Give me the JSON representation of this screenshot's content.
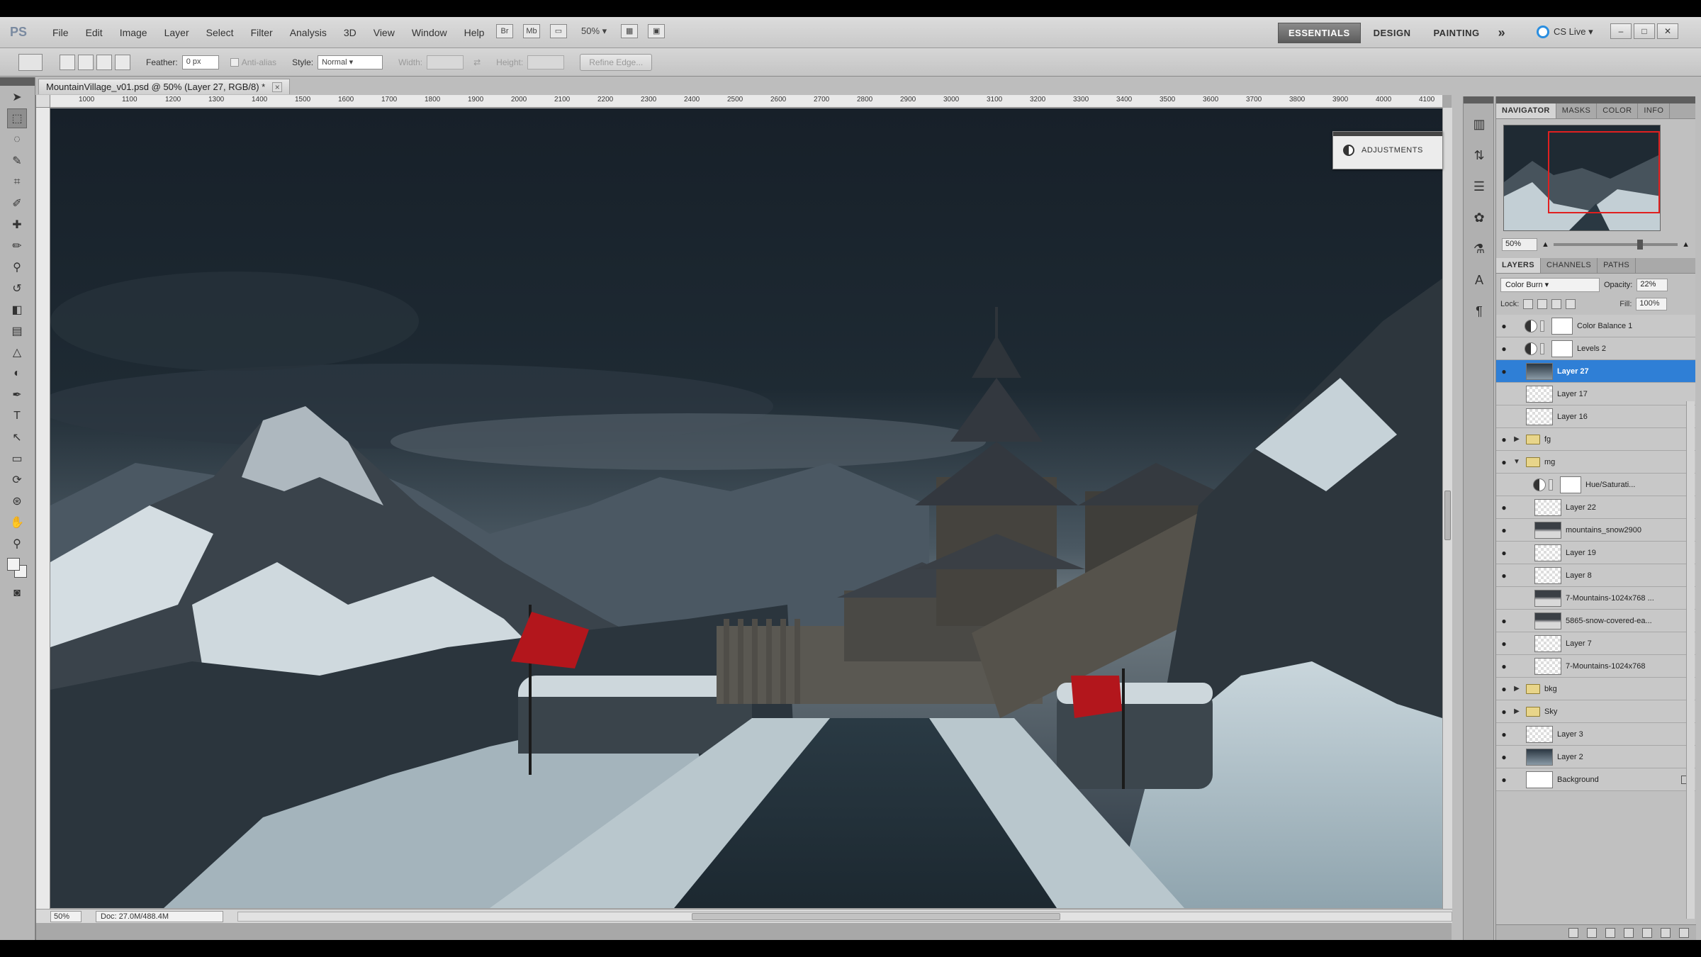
{
  "app": {
    "logo": "PS"
  },
  "menu": [
    "File",
    "Edit",
    "Image",
    "Layer",
    "Select",
    "Filter",
    "Analysis",
    "3D",
    "View",
    "Window",
    "Help"
  ],
  "menubar_zoom": "50%",
  "workspaces": {
    "essentials": "ESSENTIALS",
    "design": "DESIGN",
    "painting": "PAINTING",
    "more": "»"
  },
  "cslive": "CS Live ▾",
  "options": {
    "feather_label": "Feather:",
    "feather_value": "0 px",
    "antialias": "Anti-alias",
    "style_label": "Style:",
    "style_value": "Normal",
    "width_label": "Width:",
    "height_label": "Height:",
    "refine": "Refine Edge..."
  },
  "document": {
    "tab": "MountainVillage_v01.psd @ 50% (Layer 27, RGB/8) *",
    "zoom": "50%",
    "doc_info": "Doc: 27.0M/488.4M",
    "ruler_ticks": [
      "1000",
      "1100",
      "1200",
      "1300",
      "1400",
      "1500",
      "1600",
      "1700",
      "1800",
      "1900",
      "2000",
      "2100",
      "2200",
      "2300",
      "2400",
      "2500",
      "2600",
      "2700",
      "2800",
      "2900",
      "3000",
      "3100",
      "3200",
      "3300",
      "3400",
      "3500",
      "3600",
      "3700",
      "3800",
      "3900",
      "4000",
      "4100"
    ]
  },
  "adjustments_label": "ADJUSTMENTS",
  "navigator": {
    "tabs": [
      "NAVIGATOR",
      "MASKS",
      "COLOR",
      "INFO"
    ],
    "zoom": "50%"
  },
  "layers_panel": {
    "tabs": [
      "LAYERS",
      "CHANNELS",
      "PATHS"
    ],
    "blend_mode": "Color Burn",
    "opacity_label": "Opacity:",
    "opacity": "22%",
    "lock_label": "Lock:",
    "fill_label": "Fill:",
    "fill": "100%",
    "layers": [
      {
        "name": "Color Balance 1",
        "kind": "adjust",
        "visible": true
      },
      {
        "name": "Levels 2",
        "kind": "adjust",
        "visible": true
      },
      {
        "name": "Layer 27",
        "kind": "selected",
        "visible": true
      },
      {
        "name": "Layer 17",
        "kind": "pixel",
        "visible": false
      },
      {
        "name": "Layer 16",
        "kind": "pixel",
        "visible": false
      },
      {
        "name": "fg",
        "kind": "group",
        "visible": true,
        "expander": "▶"
      },
      {
        "name": "mg",
        "kind": "group",
        "visible": true,
        "expander": "▼"
      },
      {
        "name": "Hue/Saturati...",
        "kind": "adjust-in",
        "visible": false
      },
      {
        "name": "Layer 22",
        "kind": "pixel-in",
        "visible": true
      },
      {
        "name": "mountains_snow2900",
        "kind": "mixed-in",
        "visible": true
      },
      {
        "name": "Layer 19",
        "kind": "pixel-in",
        "visible": true
      },
      {
        "name": "Layer 8",
        "kind": "pixel-in",
        "visible": true
      },
      {
        "name": "7-Mountains-1024x768 ...",
        "kind": "mixed-in",
        "visible": false
      },
      {
        "name": "5865-snow-covered-ea...",
        "kind": "mixed-in",
        "visible": true
      },
      {
        "name": "Layer 7",
        "kind": "pixel-in",
        "visible": true
      },
      {
        "name": "7-Mountains-1024x768",
        "kind": "pixel-in",
        "visible": true
      },
      {
        "name": "bkg",
        "kind": "group",
        "visible": true,
        "expander": "▶"
      },
      {
        "name": "Sky",
        "kind": "group",
        "visible": true,
        "expander": "▶"
      },
      {
        "name": "Layer 3",
        "kind": "pixel",
        "visible": true
      },
      {
        "name": "Layer 2",
        "kind": "dark",
        "visible": true
      },
      {
        "name": "Background",
        "kind": "background",
        "visible": true
      }
    ]
  },
  "colors": {
    "selected": "#2f7fd6",
    "nav_frame": "#e02020",
    "flag": "#b3161c"
  }
}
